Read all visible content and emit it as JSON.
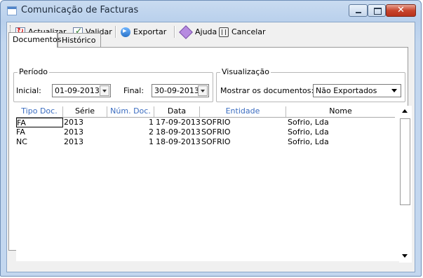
{
  "window": {
    "title": "Comunicação de Facturas"
  },
  "toolbar": {
    "refresh_label": "Actualizar",
    "validate_label": "Validar",
    "export_label": "Exportar",
    "help_label": "Ajuda",
    "cancel_label": "Cancelar"
  },
  "tabs": [
    {
      "label": "Documentos",
      "active": true
    },
    {
      "label": "Histórico",
      "active": false
    }
  ],
  "period": {
    "legend": "Período",
    "start_label": "Inicial:",
    "start_value": "01-09-2013",
    "end_label": "Final:",
    "end_value": "30-09-2013"
  },
  "view": {
    "legend": "Visualização",
    "show_label": "Mostrar os documentos:",
    "show_value": "Não Exportados"
  },
  "grid": {
    "columns": [
      "Tipo Doc.",
      "Série",
      "Núm. Doc.",
      "Data",
      "Entidade",
      "Nome"
    ],
    "rows": [
      [
        "FA",
        "2013",
        "1",
        "17-09-2013",
        "SOFRIO",
        "Sofrio, Lda"
      ],
      [
        "FA",
        "2013",
        "2",
        "18-09-2013",
        "SOFRIO",
        "Sofrio, Lda"
      ],
      [
        "NC",
        "2013",
        "1",
        "18-09-2013",
        "SOFRIO",
        "Sofrio, Lda"
      ]
    ]
  },
  "colors": {
    "header_link": "#3a6cc0",
    "close_button": "#c8452d"
  }
}
